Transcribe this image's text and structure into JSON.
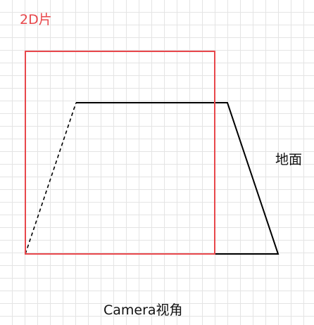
{
  "labels": {
    "slice_2d": "2D片",
    "ground": "地面",
    "camera_view": "Camera视角"
  },
  "colors": {
    "slice_2d": "#e8474b",
    "ground": "#000000",
    "background": "#ffffff",
    "grid": "#e4e4e4"
  }
}
